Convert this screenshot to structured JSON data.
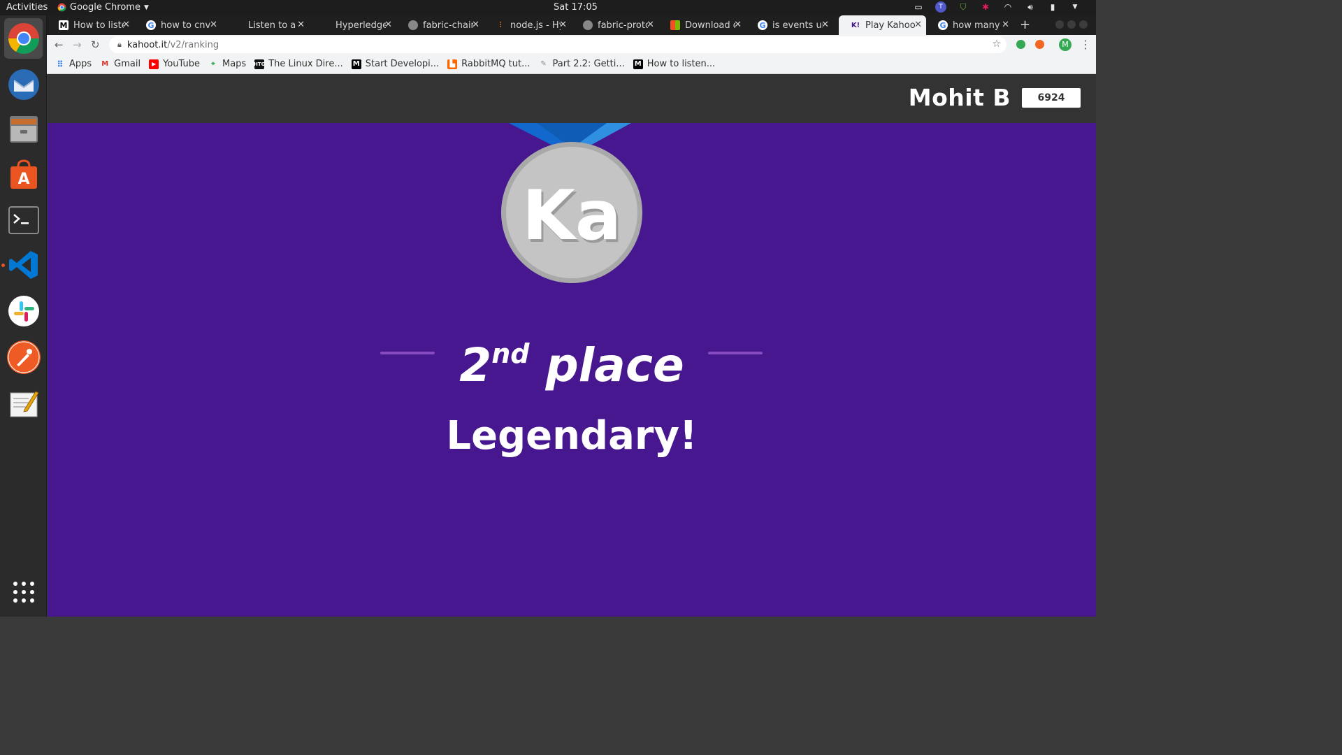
{
  "system_bar": {
    "activities": "Activities",
    "app_menu": "Google Chrome",
    "clock": "Sat 17:05"
  },
  "dock": {
    "items": [
      "chrome-icon",
      "thunderbird-icon",
      "files-icon",
      "software-icon",
      "terminal-icon",
      "vscode-icon",
      "slack-icon",
      "postman-icon",
      "text-editor-icon"
    ],
    "show_apps": "show-applications-icon"
  },
  "tabs": [
    {
      "title": "How to listen",
      "favicon": "M",
      "favicon_color": "#000000"
    },
    {
      "title": "how to cnvert",
      "favicon": "G",
      "favicon_color": "#4285f4"
    },
    {
      "title": "Listen to a cu",
      "favicon": "",
      "favicon_color": "#1f1f1f"
    },
    {
      "title": "Hyperledger",
      "favicon": "",
      "favicon_color": "#1f1f1f"
    },
    {
      "title": "fabric-chainc",
      "favicon": "gh",
      "favicon_color": "#888888"
    },
    {
      "title": "node.js - Hyp",
      "favicon": "so",
      "favicon_color": "#f48024"
    },
    {
      "title": "fabric-protos",
      "favicon": "gh",
      "favicon_color": "#888888"
    },
    {
      "title": "Download de",
      "favicon": "ms",
      "favicon_color": "#f25022"
    },
    {
      "title": "is events use",
      "favicon": "G",
      "favicon_color": "#4285f4"
    },
    {
      "title": "Play Kahoot!",
      "favicon": "K!",
      "favicon_color": "#46178f",
      "active": true
    },
    {
      "title": "how many bu",
      "favicon": "G",
      "favicon_color": "#4285f4"
    }
  ],
  "address_bar": {
    "host": "kahoot.it",
    "path": "/v2/ranking"
  },
  "bookmarks": [
    {
      "label": "Apps",
      "icon": "apps-grid-icon"
    },
    {
      "label": "Gmail",
      "icon": "gmail-icon"
    },
    {
      "label": "YouTube",
      "icon": "youtube-icon"
    },
    {
      "label": "Maps",
      "icon": "maps-icon"
    },
    {
      "label": "The Linux Dire...",
      "icon": "htg-icon"
    },
    {
      "label": "Start Developi...",
      "icon": "medium-icon"
    },
    {
      "label": "RabbitMQ tut...",
      "icon": "rabbitmq-icon"
    },
    {
      "label": "Part 2.2: Getti...",
      "icon": "article-icon"
    },
    {
      "label": "How to listen...",
      "icon": "medium-icon"
    }
  ],
  "kahoot": {
    "player_name": "Mohit B",
    "score": "6924",
    "medal_logo": "Ka",
    "place_number": "2",
    "place_suffix": "nd",
    "place_word": "place",
    "praise": "Legendary!",
    "colors": {
      "background": "#46178f",
      "header": "#333333",
      "medal": "#c4c4c4",
      "medal_ribbon": "#1368ce"
    }
  }
}
